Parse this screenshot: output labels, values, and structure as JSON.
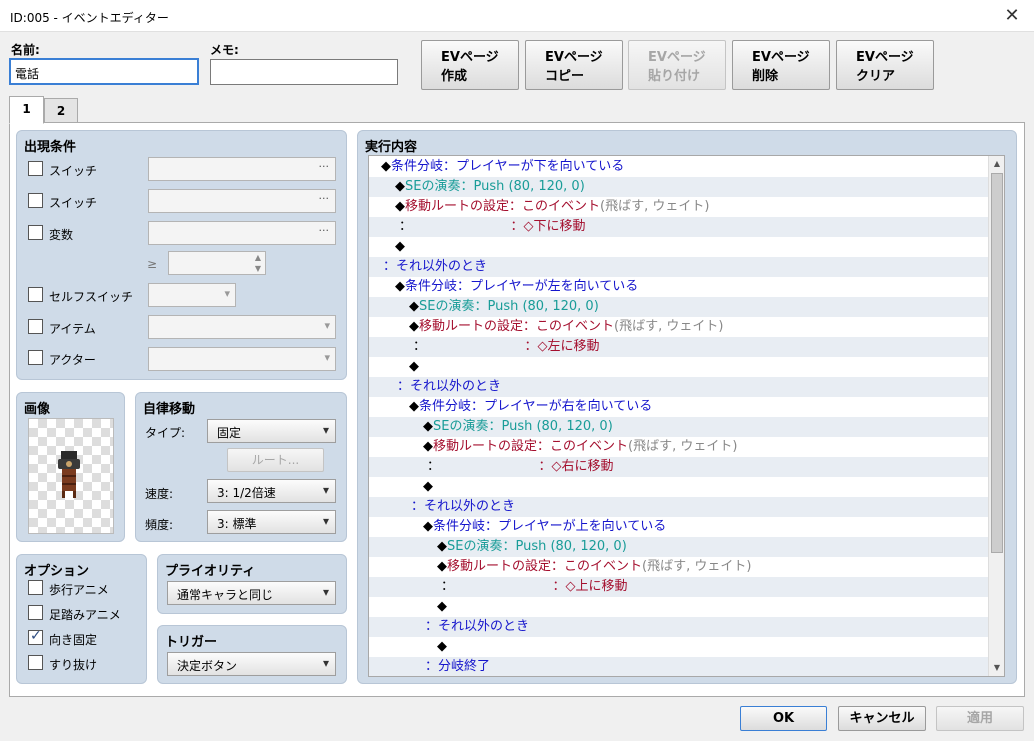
{
  "window": {
    "title": "ID:005 - イベントエディター"
  },
  "name": {
    "label": "名前:",
    "value": "電話"
  },
  "memo": {
    "label": "メモ:",
    "value": ""
  },
  "ev_buttons": [
    {
      "line1": "EVページ",
      "line2": "作成"
    },
    {
      "line1": "EVページ",
      "line2": "コピー"
    },
    {
      "line1": "EVページ",
      "line2": "貼り付け"
    },
    {
      "line1": "EVページ",
      "line2": "削除"
    },
    {
      "line1": "EVページ",
      "line2": "クリア"
    }
  ],
  "tabs": [
    "1",
    "2"
  ],
  "conditions": {
    "title": "出現条件",
    "switch1": "スイッチ",
    "switch2": "スイッチ",
    "variable": "変数",
    "gte": "≥",
    "self_switch": "セルフスイッチ",
    "item": "アイテム",
    "actor": "アクター"
  },
  "image": {
    "title": "画像"
  },
  "autonomous": {
    "title": "自律移動",
    "type_label": "タイプ:",
    "type_value": "固定",
    "route_button": "ルート...",
    "speed_label": "速度:",
    "speed_value": "3: 1/2倍速",
    "freq_label": "頻度:",
    "freq_value": "3: 標準"
  },
  "options": {
    "title": "オプション",
    "walk": "歩行アニメ",
    "step": "足踏みアニメ",
    "dirfix": "向き固定",
    "through": "すり抜け"
  },
  "priority": {
    "title": "プライオリティ",
    "value": "通常キャラと同じ"
  },
  "trigger": {
    "title": "トリガー",
    "value": "決定ボタン"
  },
  "contents": {
    "title": "実行内容",
    "lines": [
      "◆",
      "条件分岐：プレイヤーが下を向いている",
      "◆",
      "SEの演奏：Push (80, 120, 0)",
      "◆",
      "移動ルートの設定：このイベント",
      "(飛ばす, ウェイト)",
      "：",
      "：◇下に移動",
      "◆",
      "：それ以外のとき",
      "◆",
      "条件分岐：プレイヤーが左を向いている",
      "◆",
      "SEの演奏：Push (80, 120, 0)",
      "◆",
      "移動ルートの設定：このイベント",
      "(飛ばす, ウェイト)",
      "：",
      "：◇左に移動",
      "◆",
      "：それ以外のとき",
      "◆",
      "条件分岐：プレイヤーが右を向いている",
      "◆",
      "SEの演奏：Push (80, 120, 0)",
      "◆",
      "移動ルートの設定：このイベント",
      "(飛ばす, ウェイト)",
      "：",
      "：◇右に移動",
      "◆",
      "：それ以外のとき",
      "◆",
      "条件分岐：プレイヤーが上を向いている",
      "◆",
      "SEの演奏：Push (80, 120, 0)",
      "◆",
      "移動ルートの設定：このイベント",
      "(飛ばす, ウェイト)",
      "：",
      "：◇上に移動",
      "◆",
      "：それ以外のとき",
      "◆",
      "：分岐終了"
    ]
  },
  "footer": {
    "ok": "OK",
    "cancel": "キャンセル",
    "apply": "適用"
  }
}
